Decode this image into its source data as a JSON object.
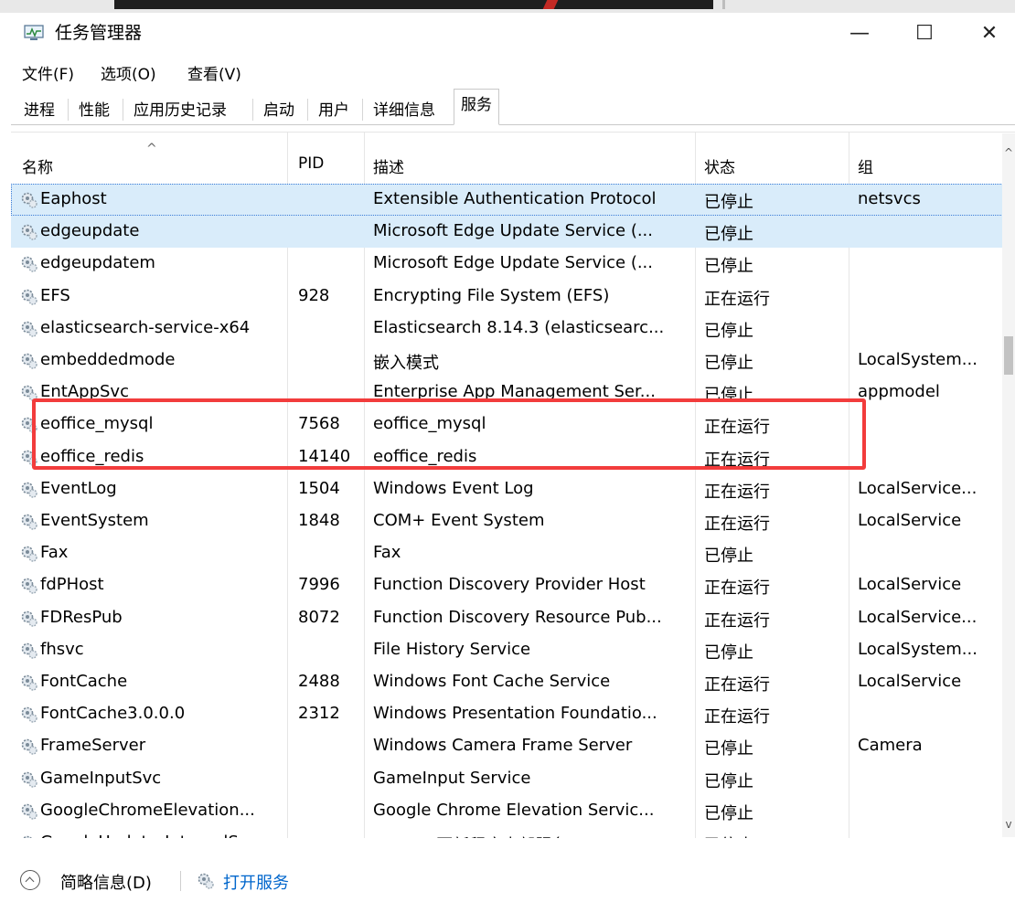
{
  "window": {
    "title": "任务管理器",
    "minimize": "—",
    "maximize": "☐",
    "close": "✕"
  },
  "menu": [
    "文件(F)",
    "选项(O)",
    "查看(V)"
  ],
  "tabs": [
    "进程",
    "性能",
    "应用历史记录",
    "启动",
    "用户",
    "详细信息",
    "服务"
  ],
  "active_tab": "服务",
  "columns": {
    "name": "名称",
    "pid": "PID",
    "desc": "描述",
    "status": "状态",
    "group": "组"
  },
  "rows": [
    {
      "name": "Eaphost",
      "pid": "",
      "desc": "Extensible Authentication Protocol",
      "status": "已停止",
      "group": "netsvcs"
    },
    {
      "name": "edgeupdate",
      "pid": "",
      "desc": "Microsoft Edge Update Service (...",
      "status": "已停止",
      "group": ""
    },
    {
      "name": "edgeupdatem",
      "pid": "",
      "desc": "Microsoft Edge Update Service (...",
      "status": "已停止",
      "group": ""
    },
    {
      "name": "EFS",
      "pid": "928",
      "desc": "Encrypting File System (EFS)",
      "status": "正在运行",
      "group": ""
    },
    {
      "name": "elasticsearch-service-x64",
      "pid": "",
      "desc": "Elasticsearch 8.14.3 (elasticsearc...",
      "status": "已停止",
      "group": ""
    },
    {
      "name": "embeddedmode",
      "pid": "",
      "desc": "嵌入模式",
      "status": "已停止",
      "group": "LocalSystem..."
    },
    {
      "name": "EntAppSvc",
      "pid": "",
      "desc": "Enterprise App Management Ser...",
      "status": "已停止",
      "group": "appmodel"
    },
    {
      "name": "eoffice_mysql",
      "pid": "7568",
      "desc": "eoffice_mysql",
      "status": "正在运行",
      "group": ""
    },
    {
      "name": "eoffice_redis",
      "pid": "14140",
      "desc": "eoffice_redis",
      "status": "正在运行",
      "group": ""
    },
    {
      "name": "EventLog",
      "pid": "1504",
      "desc": "Windows Event Log",
      "status": "正在运行",
      "group": "LocalService..."
    },
    {
      "name": "EventSystem",
      "pid": "1848",
      "desc": "COM+ Event System",
      "status": "正在运行",
      "group": "LocalService"
    },
    {
      "name": "Fax",
      "pid": "",
      "desc": "Fax",
      "status": "已停止",
      "group": ""
    },
    {
      "name": "fdPHost",
      "pid": "7996",
      "desc": "Function Discovery Provider Host",
      "status": "正在运行",
      "group": "LocalService"
    },
    {
      "name": "FDResPub",
      "pid": "8072",
      "desc": "Function Discovery Resource Pub...",
      "status": "正在运行",
      "group": "LocalService..."
    },
    {
      "name": "fhsvc",
      "pid": "",
      "desc": "File History Service",
      "status": "已停止",
      "group": "LocalSystem..."
    },
    {
      "name": "FontCache",
      "pid": "2488",
      "desc": "Windows Font Cache Service",
      "status": "正在运行",
      "group": "LocalService"
    },
    {
      "name": "FontCache3.0.0.0",
      "pid": "2312",
      "desc": "Windows Presentation Foundatio...",
      "status": "正在运行",
      "group": ""
    },
    {
      "name": "FrameServer",
      "pid": "",
      "desc": "Windows Camera Frame Server",
      "status": "已停止",
      "group": "Camera"
    },
    {
      "name": "GameInputSvc",
      "pid": "",
      "desc": "GameInput Service",
      "status": "已停止",
      "group": ""
    },
    {
      "name": "GoogleChromeElevation...",
      "pid": "",
      "desc": "Google Chrome Elevation Servic...",
      "status": "已停止",
      "group": ""
    },
    {
      "name": "GoogleUpdaterInternalS...",
      "pid": "",
      "desc": "Google 更新程序内部服务 (Googl...",
      "status": "已停止",
      "group": ""
    }
  ],
  "footer": {
    "fewer_details": "简略信息(D)",
    "open_services": "打开服务"
  },
  "colors": {
    "selected_row": "#d9ecfa",
    "highlight_box": "#f23c3c",
    "link": "#0066cc"
  }
}
